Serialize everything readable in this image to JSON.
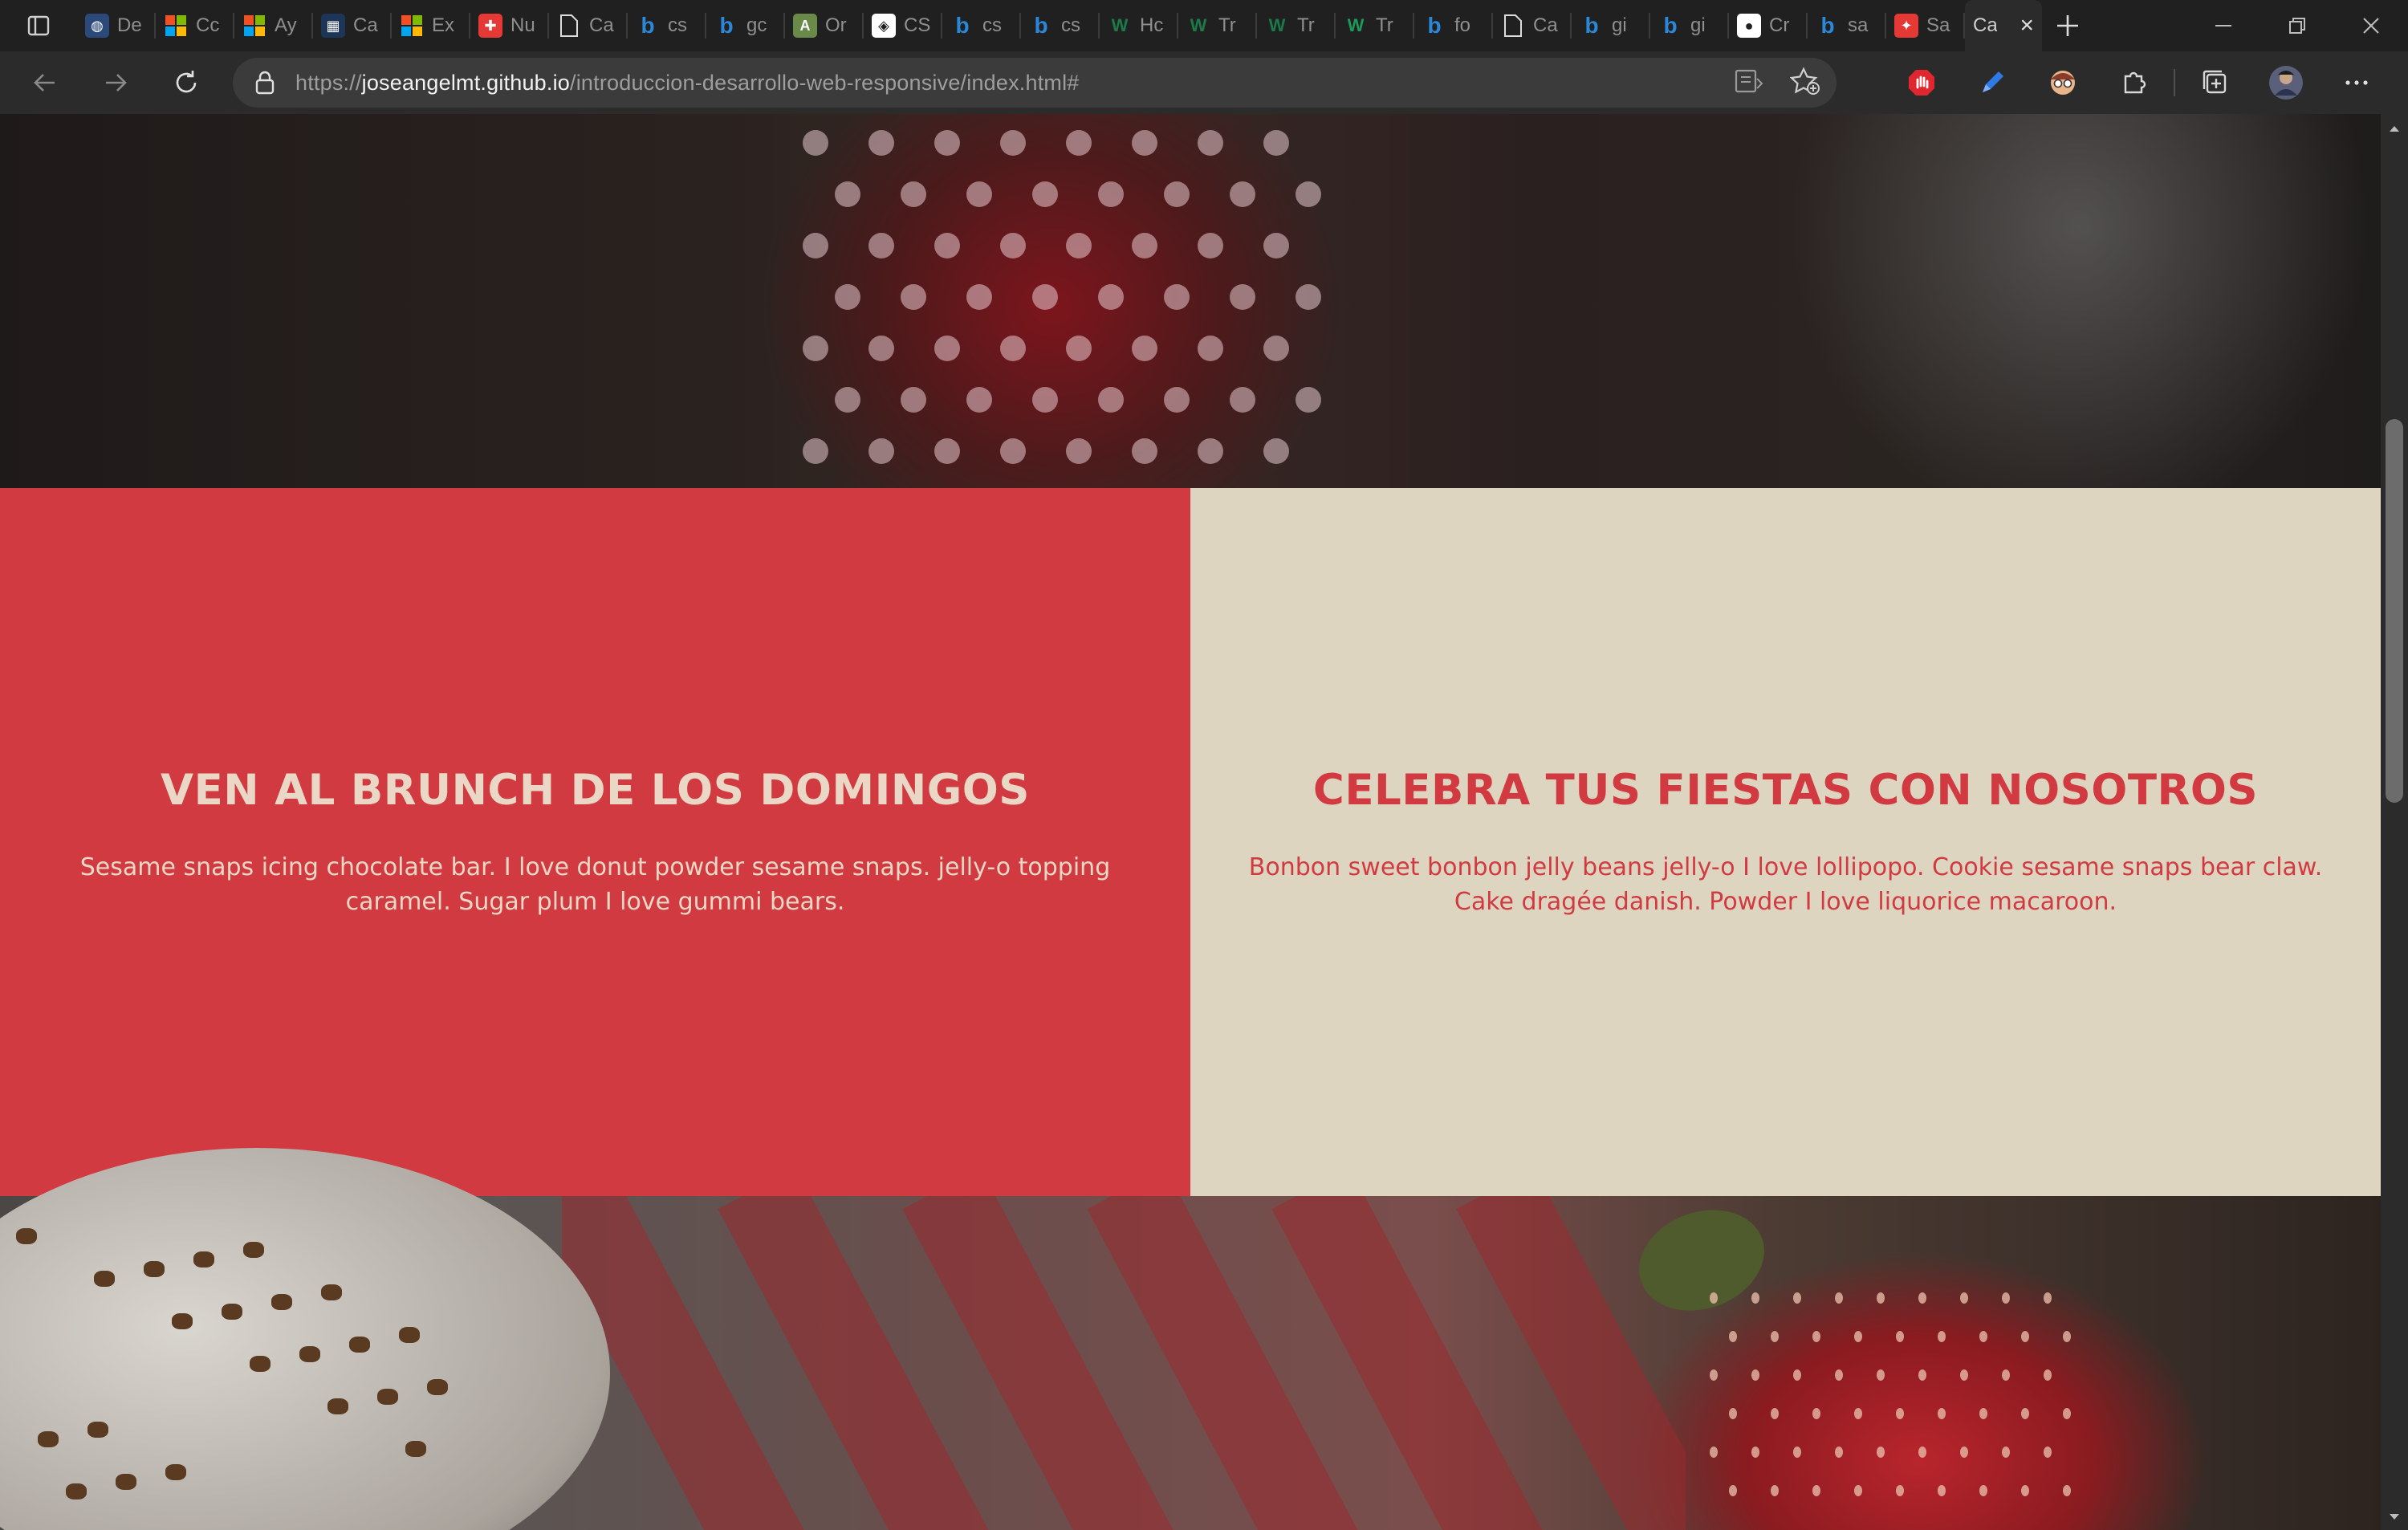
{
  "browser": {
    "tabs": [
      {
        "title": "De",
        "favicon": "globe-icon",
        "color": "#2b4a7a"
      },
      {
        "title": "Cc",
        "favicon": "microsoft-icon",
        "color": "#f25022"
      },
      {
        "title": "Ay",
        "favicon": "microsoft-icon",
        "color": "#f25022"
      },
      {
        "title": "Ca",
        "favicon": "calendar-icon",
        "color": "#1d3557"
      },
      {
        "title": "Ex",
        "favicon": "microsoft-icon",
        "color": "#f25022"
      },
      {
        "title": "Nu",
        "favicon": "shield-icon",
        "color": "#e53935"
      },
      {
        "title": "Ca",
        "favicon": "page-icon",
        "color": "#202020"
      },
      {
        "title": "cs",
        "favicon": "bing-icon",
        "color": "#2b88d8"
      },
      {
        "title": "gc",
        "favicon": "bing-icon",
        "color": "#2b88d8"
      },
      {
        "title": "Or",
        "favicon": "translate-icon",
        "color": "#6a8a4a"
      },
      {
        "title": "CS",
        "favicon": "css-icon",
        "color": "#ffffff"
      },
      {
        "title": "cs",
        "favicon": "bing-icon",
        "color": "#2b88d8"
      },
      {
        "title": "cs",
        "favicon": "bing-icon",
        "color": "#2b88d8"
      },
      {
        "title": "Hc",
        "favicon": "w-icon",
        "color": "#1b7a4a"
      },
      {
        "title": "Tr",
        "favicon": "w-icon",
        "color": "#1b7a4a"
      },
      {
        "title": "Tr",
        "favicon": "w-icon",
        "color": "#1b7a4a"
      },
      {
        "title": "Tr",
        "favicon": "w-icon",
        "color": "#1b9a5a"
      },
      {
        "title": "fo",
        "favicon": "bing-icon",
        "color": "#2b88d8"
      },
      {
        "title": "Ca",
        "favicon": "page-icon",
        "color": "#202020"
      },
      {
        "title": "gi",
        "favicon": "bing-icon",
        "color": "#2b88d8"
      },
      {
        "title": "gi",
        "favicon": "bing-icon",
        "color": "#2b88d8"
      },
      {
        "title": "Cr",
        "favicon": "github-icon",
        "color": "#ffffff"
      },
      {
        "title": "sa",
        "favicon": "bing-icon",
        "color": "#2b88d8"
      },
      {
        "title": "Sa",
        "favicon": "compass-icon",
        "color": "#e53935"
      }
    ],
    "active_tab": {
      "title": "Ca",
      "favicon": "close-icon"
    },
    "url_host": "joseangelmt.github.io",
    "url_prefix": "https://",
    "url_path": "/introduccion-desarrollo-web-responsive/index.html#"
  },
  "page": {
    "left_panel": {
      "heading": "VEN AL BRUNCH DE LOS DOMINGOS",
      "body": "Sesame snaps icing chocolate bar. I love donut powder sesame snaps. jelly-o topping caramel. Sugar plum I love gummi bears.",
      "background": "#d13a41",
      "text_color": "#ead7c5"
    },
    "right_panel": {
      "heading": "CELEBRA TUS FIESTAS CON NOSOTROS",
      "body": "Bonbon sweet bonbon jelly beans jelly-o I love lollipopo. Cookie sesame snaps bear claw. Cake dragée danish. Powder I love liquorice macaroon.",
      "background": "#ded5c1",
      "text_color": "#d13a41"
    }
  }
}
